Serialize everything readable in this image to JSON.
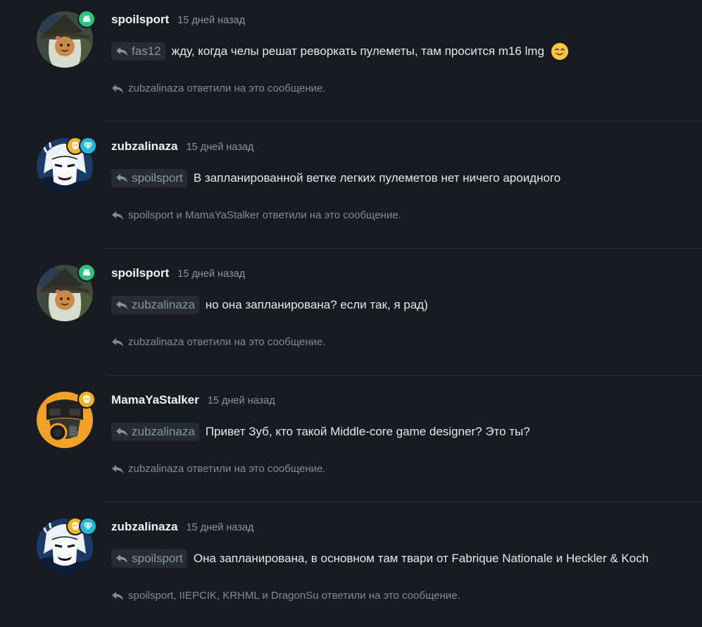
{
  "messages": [
    {
      "author": "spoilsport",
      "time": "15 дней назад",
      "reply_to": "fas12",
      "text": "жду, когда челы решат реворкать пулеметы, там просится m16 lmg",
      "emoji": "smiling-face-emoji",
      "replies": "zubzalinaza ответили на это сообщение.",
      "avatar": "witch-avatar",
      "badges": [
        "frog-badge-icon"
      ]
    },
    {
      "author": "zubzalinaza",
      "time": "15 дней назад",
      "reply_to": "spoilsport",
      "text": "В запланированной ветке легких пулеметов нет ничего ароидного",
      "replies": "spoilsport и MamaYaStalker ответили на это сообщение.",
      "avatar": "manga-avatar",
      "badges": [
        "skull-badge-icon",
        "diamond-badge-icon"
      ]
    },
    {
      "author": "spoilsport",
      "time": "15 дней назад",
      "reply_to": "zubzalinaza",
      "text": "но она запланирована? если так, я рад)",
      "replies": "zubzalinaza ответили на это сообщение.",
      "avatar": "witch-avatar",
      "badges": [
        "frog-badge-icon"
      ]
    },
    {
      "author": "MamaYaStalker",
      "time": "15 дней назад",
      "reply_to": "zubzalinaza",
      "text": "Привет Зуб, кто такой Middle-core game designer? Это ты?",
      "replies": "zubzalinaza ответили на это сообщение.",
      "avatar": "gas-mask-avatar",
      "badges": [
        "skull-badge-icon"
      ]
    },
    {
      "author": "zubzalinaza",
      "time": "15 дней назад",
      "reply_to": "spoilsport",
      "text": "Она запланирована, в основном там твари от Fabrique Nationale и Heckler & Koch",
      "replies": "spoilsport, IIEPCIK, KRHML и DragonSu ответили на это сообщение.",
      "avatar": "manga-avatar",
      "badges": [
        "skull-badge-icon",
        "diamond-badge-icon"
      ]
    }
  ],
  "colors": {
    "background": "#181c20",
    "mention_bg": "#262c32",
    "muted_text": "#7f8b96",
    "badge_green": "#2ec27e",
    "badge_gold": "#f0b429",
    "badge_cyan": "#22b8d9"
  }
}
